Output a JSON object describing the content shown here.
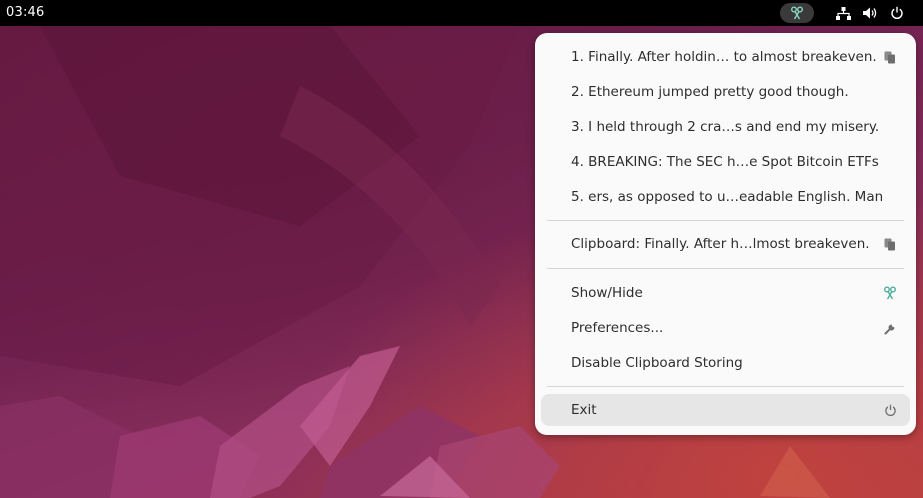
{
  "topbar": {
    "time": "03:46",
    "icons": [
      "clipboard-indicator-icon",
      "network-icon",
      "volume-icon",
      "power-icon"
    ]
  },
  "menu": {
    "history": [
      {
        "label": "1. Finally. After holdin… to almost breakeven.",
        "icon": "copy-icon"
      },
      {
        "label": "2. Ethereum jumped pretty good though."
      },
      {
        "label": "3. I held through 2 cra…s and end my misery."
      },
      {
        "label": "4. BREAKING: The SEC h…e Spot Bitcoin ETFs"
      },
      {
        "label": "5. ers, as opposed to u…eadable English. Man"
      }
    ],
    "clipboard": {
      "label": "Clipboard: Finally. After h…lmost breakeven.",
      "icon": "copy-icon"
    },
    "actions": [
      {
        "label": "Show/Hide",
        "icon": "clipboard-indicator-icon"
      },
      {
        "label": "Preferences...",
        "icon": "wrench-icon"
      },
      {
        "label": "Disable Clipboard Storing"
      }
    ],
    "exit": {
      "label": "Exit",
      "icon": "power-icon"
    }
  },
  "colors": {
    "accent_tray": "#3a3a3a",
    "menu_bg": "#fafafa",
    "highlight": "#e6e6e6",
    "icon_teal": "#8ad6c6"
  }
}
